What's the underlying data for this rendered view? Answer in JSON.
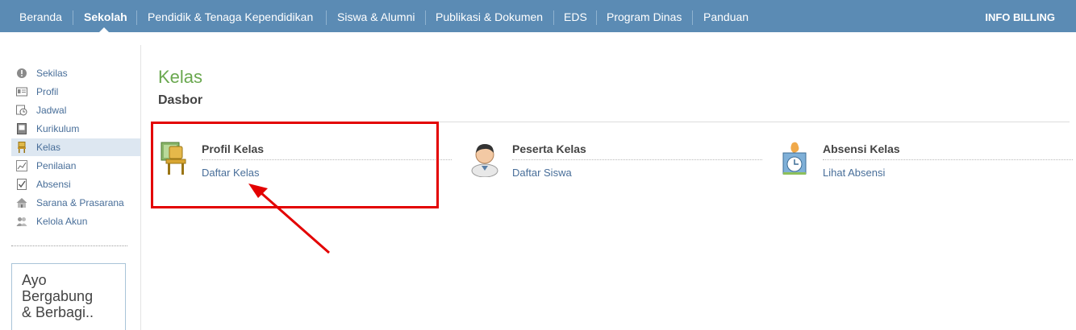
{
  "nav": {
    "items": [
      {
        "label": "Beranda"
      },
      {
        "label": "Sekolah"
      },
      {
        "label": "Pendidik & Tenaga Kependidikan"
      },
      {
        "label": "Siswa & Alumni"
      },
      {
        "label": "Publikasi & Dokumen"
      },
      {
        "label": "EDS"
      },
      {
        "label": "Program Dinas"
      },
      {
        "label": "Panduan"
      }
    ],
    "active": "Sekolah",
    "billing": "INFO BILLING",
    "bg_color": "#5b8bb4"
  },
  "sidebar": {
    "items": [
      {
        "label": "Sekilas",
        "icon": "info-icon"
      },
      {
        "label": "Profil",
        "icon": "profile-card-icon"
      },
      {
        "label": "Jadwal",
        "icon": "schedule-clock-icon"
      },
      {
        "label": "Kurikulum",
        "icon": "book-icon"
      },
      {
        "label": "Kelas",
        "icon": "chair-icon"
      },
      {
        "label": "Penilaian",
        "icon": "chart-icon"
      },
      {
        "label": "Absensi",
        "icon": "checklist-icon"
      },
      {
        "label": "Sarana & Prasarana",
        "icon": "building-icon"
      },
      {
        "label": "Kelola Akun",
        "icon": "users-icon"
      }
    ],
    "active": "Kelas",
    "join": {
      "line1": "Ayo",
      "line2": "Bergabung",
      "line3": "& Berbagi.."
    }
  },
  "main": {
    "title": "Kelas",
    "subtitle": "Dasbor",
    "cards": [
      {
        "title": "Profil Kelas",
        "link": "Daftar Kelas",
        "icon": "classroom-chair-icon"
      },
      {
        "title": "Peserta Kelas",
        "link": "Daftar Siswa",
        "icon": "student-icon"
      },
      {
        "title": "Absensi Kelas",
        "link": "Lihat Absensi",
        "icon": "attendance-clock-icon"
      }
    ]
  },
  "colors": {
    "accent_green": "#6aa84f",
    "link_blue": "#486e99",
    "highlight_red": "#e30000"
  }
}
